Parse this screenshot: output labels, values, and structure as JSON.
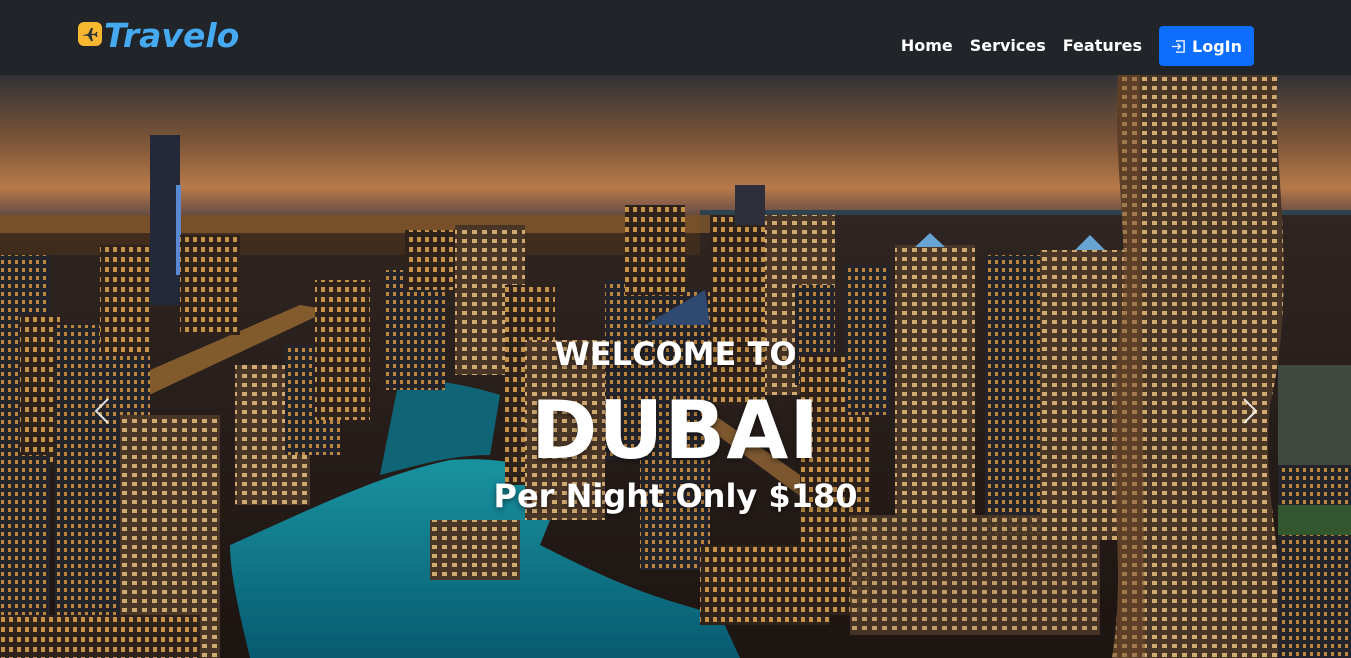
{
  "brand": {
    "name": "Travelo",
    "icon": "airplane-icon",
    "icon_color": "#f7b731",
    "text_color": "#45aaf2"
  },
  "nav": {
    "items": [
      {
        "label": "Home"
      },
      {
        "label": "Services"
      },
      {
        "label": "Features"
      }
    ],
    "login_label": "LogIn",
    "login_icon": "login-arrow-icon",
    "login_color": "#0d6efd",
    "bar_color": "#212529"
  },
  "hero": {
    "welcome": "WELCOME TO",
    "city": "DUBAI",
    "price_text": "Per Night Only $180",
    "prev_icon": "chevron-left-icon",
    "next_icon": "chevron-right-icon"
  }
}
